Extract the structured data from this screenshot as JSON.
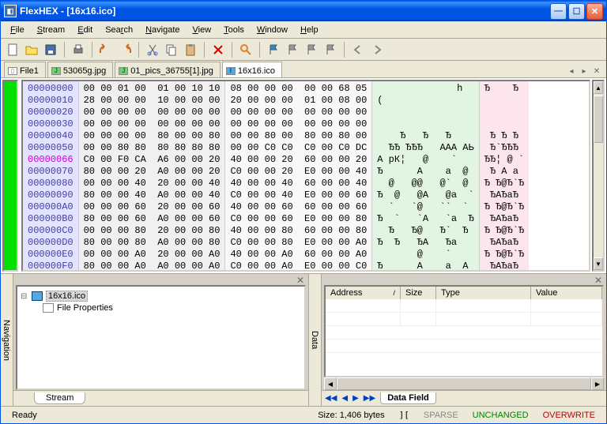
{
  "window": {
    "title": "FlexHEX - [16x16.ico]"
  },
  "menus": {
    "file": "File",
    "stream": "Stream",
    "edit": "Edit",
    "search": "Search",
    "navigate": "Navigate",
    "view": "View",
    "tools": "Tools",
    "window": "Window",
    "help": "Help"
  },
  "toolbar_icons": {
    "new": "new-file-icon",
    "open": "open-folder-icon",
    "save": "save-icon",
    "print": "print-icon",
    "undo": "undo-icon",
    "redo": "redo-icon",
    "cut": "cut-icon",
    "copy": "copy-icon",
    "paste": "paste-icon",
    "delete": "delete-icon",
    "find": "find-icon",
    "flag": "flag-icon",
    "bm1": "bookmark-icon",
    "bm2": "bookmark-next-icon",
    "bm3": "bookmark-prev-icon",
    "back": "back-icon",
    "fwd": "forward-icon"
  },
  "tabs": [
    {
      "label": "File1",
      "icon": "doc",
      "active": false
    },
    {
      "label": "53065g.jpg",
      "icon": "jpg",
      "active": false
    },
    {
      "label": "01_pics_36755[1].jpg",
      "icon": "jpg",
      "active": false
    },
    {
      "label": "16x16.ico",
      "icon": "ico",
      "active": true
    }
  ],
  "hex": {
    "offsets": [
      "00000000",
      "00000010",
      "00000020",
      "00000030",
      "00000040",
      "00000050",
      "00000066",
      "00000070",
      "00000080",
      "00000090",
      "000000A0",
      "000000B0",
      "000000C0",
      "000000D0",
      "000000E0",
      "000000F0"
    ],
    "highlight_row": 6,
    "groupA": [
      "00 00 01 00  01 00 10 10",
      "28 00 00 00  10 00 00 00",
      "00 00 00 00  00 00 00 00",
      "00 00 00 00  00 00 00 00",
      "00 00 00 00  80 00 00 80",
      "00 00 80 80  80 80 80 80",
      "C0 00 F0 CA  A6 00 00 20",
      "80 00 00 20  A0 00 00 20",
      "00 00 00 40  20 00 00 40",
      "80 00 00 40  A0 00 00 40",
      "00 00 00 60  20 00 00 60",
      "80 00 00 60  A0 00 00 60",
      "00 00 00 80  20 00 00 80",
      "80 00 00 80  A0 00 00 80",
      "00 00 00 A0  20 00 00 A0",
      "80 00 00 A0  A0 00 00 A0"
    ],
    "groupB": [
      "08 00 00 00  00 00 68 05",
      "20 00 00 00  01 00 08 00",
      "00 00 00 00  00 00 00 00",
      "00 00 00 00  00 00 00 00",
      "00 00 80 00  80 00 80 00",
      "00 00 C0 C0  C0 00 C0 DC",
      "40 00 00 20  60 00 00 20",
      "C0 00 00 20  E0 00 00 40",
      "40 00 00 40  60 00 00 40",
      "C0 00 00 40  E0 00 00 60",
      "40 00 00 60  60 00 00 60",
      "C0 00 00 60  E0 00 00 80",
      "40 00 00 80  60 00 00 80",
      "C0 00 00 80  E0 00 00 A0",
      "40 00 00 A0  60 00 00 A0",
      "C0 00 00 A0  E0 00 00 C0"
    ],
    "asciiA": [
      "              h ",
      "(               ",
      "                ",
      "                ",
      "    Ђ   Ђ   Ђ   ",
      "  ЂЂ ЂЂЂ   ААА АЬ",
      "А рК¦   @    `  ",
      "Ђ      А    а  @",
      "  @   @@   @`  @",
      "Ђ  @   @А   @а  `",
      "  `   `@   ``  `",
      "Ђ  `   `А   `а  Ђ",
      "  Ђ   Ђ@   Ђ`  Ђ",
      "Ђ  Ђ   ЂА   Ђа   ",
      "       @    `   ",
      "Ђ      А    а  A"
    ],
    "asciiB": [
      "Ђ    Ђ",
      "      ",
      "      ",
      "      ",
      " Ђ Ђ Ђ",
      " Ђ`ЂЂЂ",
      "ЂЂ¦ @ `",
      " Ђ А а",
      "Ђ Ђ@Ђ`Ђ",
      " ЂАЂаЂ",
      "Ђ Ђ@Ђ`Ђ",
      " ЂАЂаЂ",
      "Ђ Ђ@Ђ`Ђ",
      " ЂАЂаЂ",
      "Ђ Ђ@Ђ`Ђ",
      " ЂАЂаЂ"
    ]
  },
  "tree": {
    "label": "Navigation",
    "root": "16x16.ico",
    "child": "File Properties",
    "bottom_tab": "Stream"
  },
  "datapanel": {
    "label": "Data",
    "cols": {
      "address": "Address",
      "size": "Size",
      "type": "Type",
      "value": "Value"
    },
    "bottom_tab": "Data Field"
  },
  "status": {
    "ready": "Ready",
    "size": "Size: 1,406 bytes",
    "sparse": "SPARSE",
    "unchanged": "UNCHANGED",
    "overwrite": "OVERWRITE"
  }
}
